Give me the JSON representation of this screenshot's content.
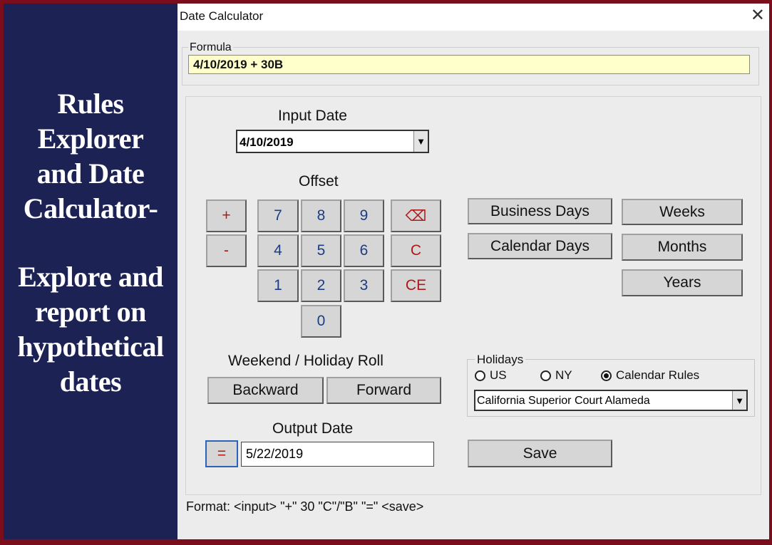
{
  "side": {
    "title_lines": [
      "Rules",
      "Explorer",
      "and Date",
      "Calculator-"
    ],
    "subtitle_lines": [
      "Explore and",
      "report on",
      "hypothetical",
      "dates"
    ]
  },
  "window": {
    "title": "Date Calculator",
    "close_glyph": "✕",
    "close_icon": "close-icon"
  },
  "formula": {
    "legend": "Formula",
    "value": "4/10/2019 + 30B"
  },
  "input_date": {
    "label": "Input Date",
    "value": "4/10/2019",
    "arrow_icon": "chevron-down-icon"
  },
  "offset": {
    "label": "Offset",
    "plus": "+",
    "minus": "-",
    "digits": [
      "7",
      "8",
      "9",
      "4",
      "5",
      "6",
      "1",
      "2",
      "3",
      "0"
    ],
    "backspace_glyph": "⌫",
    "backspace_icon": "backspace-icon",
    "clear": "C",
    "clear_entry": "CE"
  },
  "units": {
    "business_days": "Business Days",
    "calendar_days": "Calendar Days",
    "weeks": "Weeks",
    "months": "Months",
    "years": "Years"
  },
  "roll": {
    "label": "Weekend / Holiday Roll",
    "backward": "Backward",
    "forward": "Forward"
  },
  "holidays": {
    "legend": "Holidays",
    "options": [
      {
        "label": "US",
        "selected": false
      },
      {
        "label": "NY",
        "selected": false
      },
      {
        "label": "Calendar Rules",
        "selected": true
      }
    ],
    "calendar": "California Superior Court Alameda"
  },
  "output": {
    "label": "Output Date",
    "equals": "=",
    "value": "5/22/2019"
  },
  "save": "Save",
  "format_hint": "Format:  <input>  \"+\"  30  \"C\"/\"B\"  \"=\"  <save>",
  "colors": {
    "frame": "#7a0e1c",
    "side_panel": "#1c2254",
    "formula_bg": "#ffffcc",
    "digit_text": "#1b3d84",
    "op_text": "#b01818"
  }
}
